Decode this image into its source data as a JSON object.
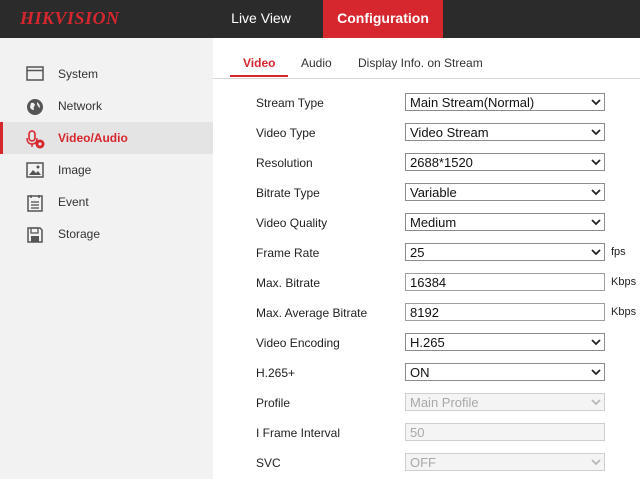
{
  "header": {
    "logo": "HIKVISION",
    "tabs": [
      {
        "label": "Live View"
      },
      {
        "label": "Configuration"
      }
    ]
  },
  "sidebar": {
    "items": [
      {
        "label": "System",
        "icon": "monitor-icon"
      },
      {
        "label": "Network",
        "icon": "globe-icon"
      },
      {
        "label": "Video/Audio",
        "icon": "microphone-camera-icon"
      },
      {
        "label": "Image",
        "icon": "image-icon"
      },
      {
        "label": "Event",
        "icon": "list-icon"
      },
      {
        "label": "Storage",
        "icon": "floppy-disk-icon"
      }
    ],
    "active_index": 2
  },
  "subtabs": [
    {
      "label": "Video"
    },
    {
      "label": "Audio"
    },
    {
      "label": "Display Info. on Stream"
    }
  ],
  "form": {
    "stream_type": {
      "label": "Stream Type",
      "value": "Main Stream(Normal)"
    },
    "video_type": {
      "label": "Video Type",
      "value": "Video Stream"
    },
    "resolution": {
      "label": "Resolution",
      "value": "2688*1520"
    },
    "bitrate_type": {
      "label": "Bitrate Type",
      "value": "Variable"
    },
    "video_quality": {
      "label": "Video Quality",
      "value": "Medium"
    },
    "frame_rate": {
      "label": "Frame Rate",
      "value": "25",
      "unit": "fps"
    },
    "max_bitrate": {
      "label": "Max. Bitrate",
      "value": "16384",
      "unit": "Kbps"
    },
    "max_avg_bitrate": {
      "label": "Max. Average Bitrate",
      "value": "8192",
      "unit": "Kbps"
    },
    "video_encoding": {
      "label": "Video Encoding",
      "value": "H.265"
    },
    "h265plus": {
      "label": "H.265+",
      "value": "ON"
    },
    "profile": {
      "label": "Profile",
      "value": "Main Profile"
    },
    "i_frame_interval": {
      "label": "I Frame Interval",
      "value": "50"
    },
    "svc": {
      "label": "SVC",
      "value": "OFF"
    }
  },
  "colors": {
    "accent": "#d6262e",
    "topbar": "#2b2b2b",
    "sidebar": "#f2f2f2"
  }
}
